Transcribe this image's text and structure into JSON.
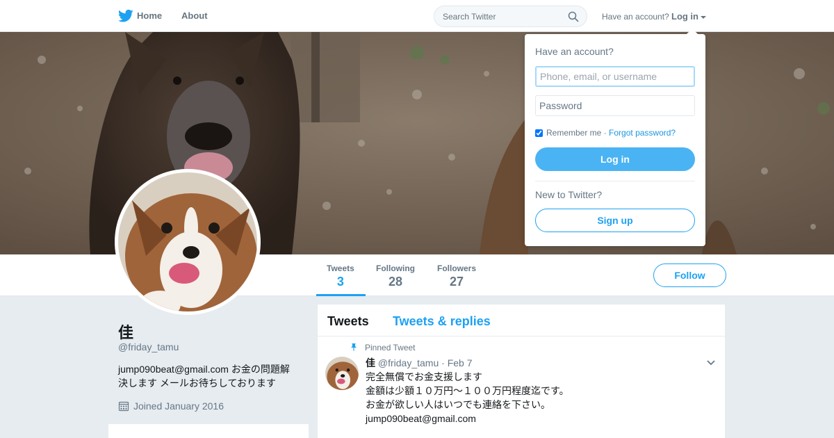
{
  "colors": {
    "brand": "#1da1f2",
    "link": "#1b95e0",
    "login_button": "#4ab3f4",
    "secondary_text": "#657786",
    "page_background": "#e6ecf0"
  },
  "nav": {
    "logo_icon": "twitter-bird-icon",
    "home_label": "Home",
    "about_label": "About",
    "search_placeholder": "Search Twitter",
    "search_icon": "search-icon",
    "have_account": "Have an account?",
    "login_label": "Log in"
  },
  "profile_nav": {
    "stats": [
      {
        "label": "Tweets",
        "value": "3",
        "active": true
      },
      {
        "label": "Following",
        "value": "28",
        "active": false
      },
      {
        "label": "Followers",
        "value": "27",
        "active": false
      }
    ],
    "follow_label": "Follow"
  },
  "profile": {
    "name": "佳",
    "handle": "@friday_tamu",
    "bio_line1": "jump090beat@gmail.com お金の問題解",
    "bio_line2": "決します メールお待ちしております",
    "joined": "Joined January 2016"
  },
  "timeline": {
    "tabs": [
      "Tweets",
      "Tweets & replies"
    ],
    "pinned_label": "Pinned Tweet",
    "tweet": {
      "name": "佳",
      "handle": "@friday_tamu",
      "separator": "·",
      "date": "Feb 7",
      "lines": [
        "完全無償でお金支援します",
        "金額は少額１０万円～１００万円程度迄です。",
        "お金が欲しい人はいつでも連絡を下さい。",
        "jump090beat@gmail.com"
      ]
    }
  },
  "login_dropdown": {
    "title": "Have an account?",
    "username_placeholder": "Phone, email, or username",
    "password_placeholder": "Password",
    "remember_label": "Remember me",
    "separator": "·",
    "forgot_label": "Forgot password?",
    "login_button": "Log in",
    "new_prompt": "New to Twitter?",
    "signup_button": "Sign up"
  }
}
